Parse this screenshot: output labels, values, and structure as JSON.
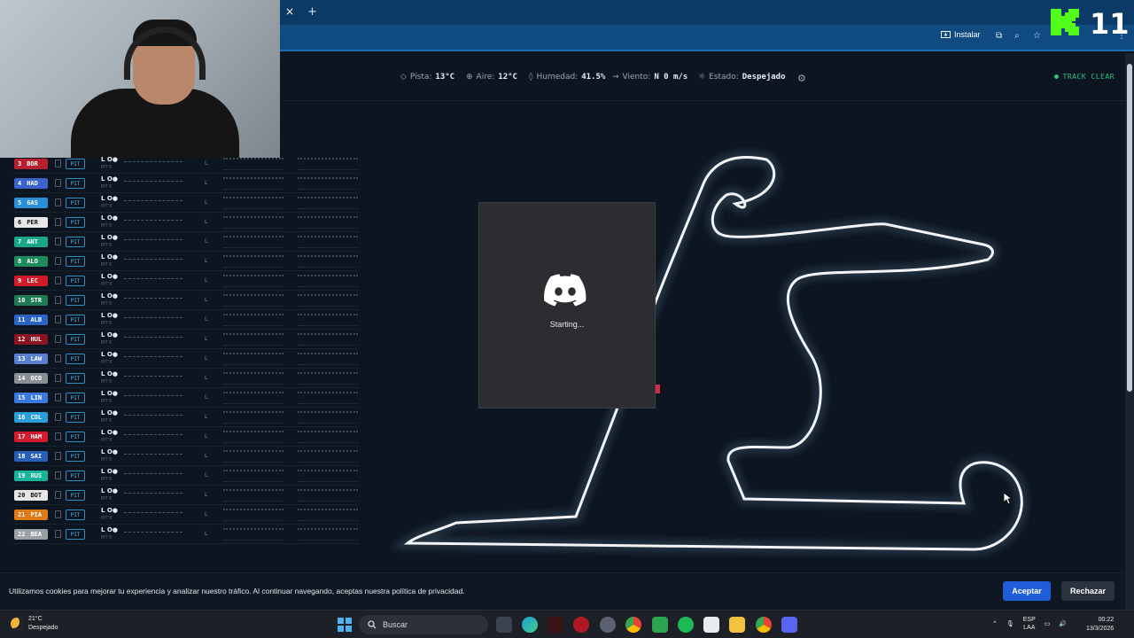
{
  "browser": {
    "install_label": "Instalar",
    "tab_close_glyph": "×",
    "tab_new_glyph": "+"
  },
  "kick_logo": {
    "text": "K",
    "number": "11",
    "color": "#53fc18"
  },
  "weather": {
    "track_label": "Pista:",
    "track_value": "13°C",
    "air_label": "Aire:",
    "air_value": "12°C",
    "humidity_label": "Humedad:",
    "humidity_value": "41.5%",
    "wind_label": "Viento:",
    "wind_value": "N 0 m/s",
    "state_label": "Estado:",
    "state_value": "Despejado",
    "track_status": "TRACK CLEAR"
  },
  "drivers": [
    {
      "pos": "3",
      "code": "BOR",
      "color": "#b3202e"
    },
    {
      "pos": "4",
      "code": "HAD",
      "color": "#3b63c9"
    },
    {
      "pos": "5",
      "code": "GAS",
      "color": "#2a8fd6"
    },
    {
      "pos": "6",
      "code": "PER",
      "color": "#e8e8e8"
    },
    {
      "pos": "7",
      "code": "ANT",
      "color": "#1aa789"
    },
    {
      "pos": "8",
      "code": "ALO",
      "color": "#1f8a5a"
    },
    {
      "pos": "9",
      "code": "LEC",
      "color": "#d11a2a"
    },
    {
      "pos": "10",
      "code": "STR",
      "color": "#1f7a55"
    },
    {
      "pos": "11",
      "code": "ALB",
      "color": "#2a64c4"
    },
    {
      "pos": "12",
      "code": "HUL",
      "color": "#8a1422"
    },
    {
      "pos": "13",
      "code": "LAW",
      "color": "#5a7fd0"
    },
    {
      "pos": "14",
      "code": "OCO",
      "color": "#8b9096"
    },
    {
      "pos": "15",
      "code": "LIN",
      "color": "#3a79e0"
    },
    {
      "pos": "16",
      "code": "COL",
      "color": "#2a9ed8"
    },
    {
      "pos": "17",
      "code": "HAM",
      "color": "#d41a2c"
    },
    {
      "pos": "18",
      "code": "SAI",
      "color": "#2a5fb8"
    },
    {
      "pos": "19",
      "code": "RUS",
      "color": "#17b39a"
    },
    {
      "pos": "20",
      "code": "BOT",
      "color": "#e6e6e6"
    },
    {
      "pos": "21",
      "code": "PIA",
      "color": "#e07a16"
    },
    {
      "pos": "22",
      "code": "BEA",
      "color": "#9aa0a6"
    }
  ],
  "timing": {
    "pit_label": "PIT",
    "lap_label": "L O●",
    "lap_sub": "PIT 0",
    "lap_marker": "L"
  },
  "discord": {
    "status": "Starting..."
  },
  "cookie": {
    "text": "Utilizamos cookies para mejorar tu experiencia y analizar nuestro tráfico. Al continuar navegando, aceptas nuestra política de privacidad.",
    "accept_label": "Aceptar",
    "reject_label": "Rechazar"
  },
  "taskbar": {
    "temp": "21°C",
    "condition": "Despejado",
    "search_placeholder": "Buscar",
    "lang_line1": "ESP",
    "lang_line2": "LAA",
    "time": "00:22",
    "date": "13/3/2026"
  }
}
